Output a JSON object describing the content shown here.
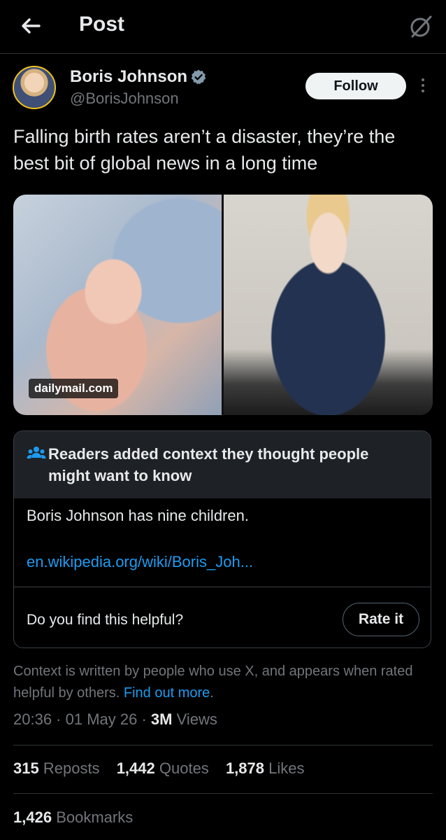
{
  "header": {
    "title": "Post",
    "back_icon": "arrow-left-icon",
    "grok_icon": "grok-icon"
  },
  "author": {
    "name": "Boris Johnson",
    "handle": "@BorisJohnson",
    "verified_icon": "verified-badge-icon",
    "follow_label": "Follow",
    "more_icon": "more-vertical-icon"
  },
  "post": {
    "text": "Falling birth rates aren’t a disaster, they’re the best bit of global news in a long time",
    "media": {
      "source_label": "dailymail.com"
    }
  },
  "community_note": {
    "header_icon": "people-icon",
    "header_text": "Readers added context they thought people might want to know",
    "body": "Boris Johnson has nine children.",
    "link": "en.wikipedia.org/wiki/Boris_Joh...",
    "question": "Do you find this helpful?",
    "rate_label": "Rate it"
  },
  "context_disclaimer": {
    "text": "Context is written by people who use X, and appears when rated helpful by others.",
    "link": "Find out more",
    "trailing": "."
  },
  "meta": {
    "time": "20:36",
    "sep1": " · ",
    "date": "01 May 26",
    "sep2": " · ",
    "views_count": "3M",
    "views_label": " Views"
  },
  "stats": {
    "reposts_count": "315",
    "reposts_label": "Reposts",
    "quotes_count": "1,442",
    "quotes_label": "Quotes",
    "likes_count": "1,878",
    "likes_label": "Likes",
    "bookmarks_count": "1,426",
    "bookmarks_label": "Bookmarks"
  },
  "colors": {
    "background": "#000000",
    "text": "#e7e9ea",
    "muted": "#71767b",
    "link": "#1d9bf0",
    "verified": "#829aab",
    "divider": "#2f3336"
  }
}
